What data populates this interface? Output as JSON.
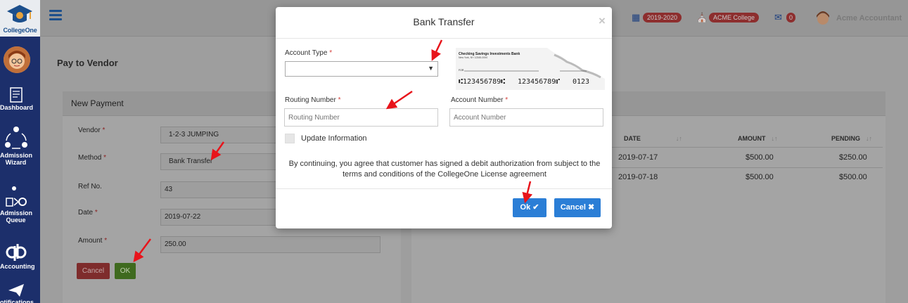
{
  "brand": {
    "name": "CollegeOne"
  },
  "sidebar": {
    "items": [
      {
        "label": "Dashboard",
        "icon": "dashboard-icon"
      },
      {
        "label": "Admission Wizard",
        "icon": "admission-wizard-icon"
      },
      {
        "label": "Admission Queue",
        "icon": "admission-queue-icon"
      },
      {
        "label": "Accounting",
        "icon": "quickbooks-icon"
      },
      {
        "label": "otifications",
        "icon": "paper-plane-icon"
      }
    ]
  },
  "topbar": {
    "year_badge": "2019-2020",
    "college_badge": "ACME College",
    "mail_count": "0",
    "user_name": "Acme Accountant"
  },
  "page": {
    "title": "Pay to Vendor",
    "panel_title": "New Payment",
    "form": {
      "vendor_label": "Vendor",
      "vendor_value": "1-2-3 JUMPING",
      "method_label": "Method",
      "method_value": "Bank Transfer",
      "ref_label": "Ref No.",
      "ref_value": "43",
      "date_label": "Date",
      "date_value": "2019-07-22",
      "amount_label": "Amount",
      "amount_value": "250.00",
      "required_mark": "*"
    },
    "cancel_label": "Cancel",
    "ok_label": "OK",
    "table": {
      "headers": {
        "date": "DATE",
        "amount": "AMOUNT",
        "pending": "PENDING",
        "sort_glyph": "↓↑"
      },
      "rows": [
        {
          "date": "2019-07-17",
          "amount": "$500.00",
          "pending": "$250.00"
        },
        {
          "date": "2019-07-18",
          "amount": "$500.00",
          "pending": "$500.00"
        }
      ]
    }
  },
  "modal": {
    "title": "Bank Transfer",
    "close_glyph": "×",
    "account_type_label": "Account Type",
    "routing_label": "Routing Number",
    "routing_placeholder": "Routing Number",
    "account_label": "Account Number",
    "account_placeholder": "Account Number",
    "required_mark": "*",
    "update_info_label": "Update Information",
    "agreement_text": "By continuing, you agree that customer has signed a debit authorization from subject to the terms and conditions of the CollegeOne License agreement",
    "ok_label": "Ok ✔",
    "cancel_label": "Cancel ✖",
    "cheque": {
      "bank_name": "Checking Savings Investments Bank",
      "bank_address": "New York, NY 12345-0000",
      "for_label": "FOR",
      "micr_routing": "⑆123456789⑆",
      "micr_account": "123456789⑈",
      "micr_check": "0123"
    }
  },
  "colors": {
    "primary_button": "#2b7ed6",
    "sidebar": "#1c2f6b",
    "annotation_arrow": "#e8141b"
  }
}
